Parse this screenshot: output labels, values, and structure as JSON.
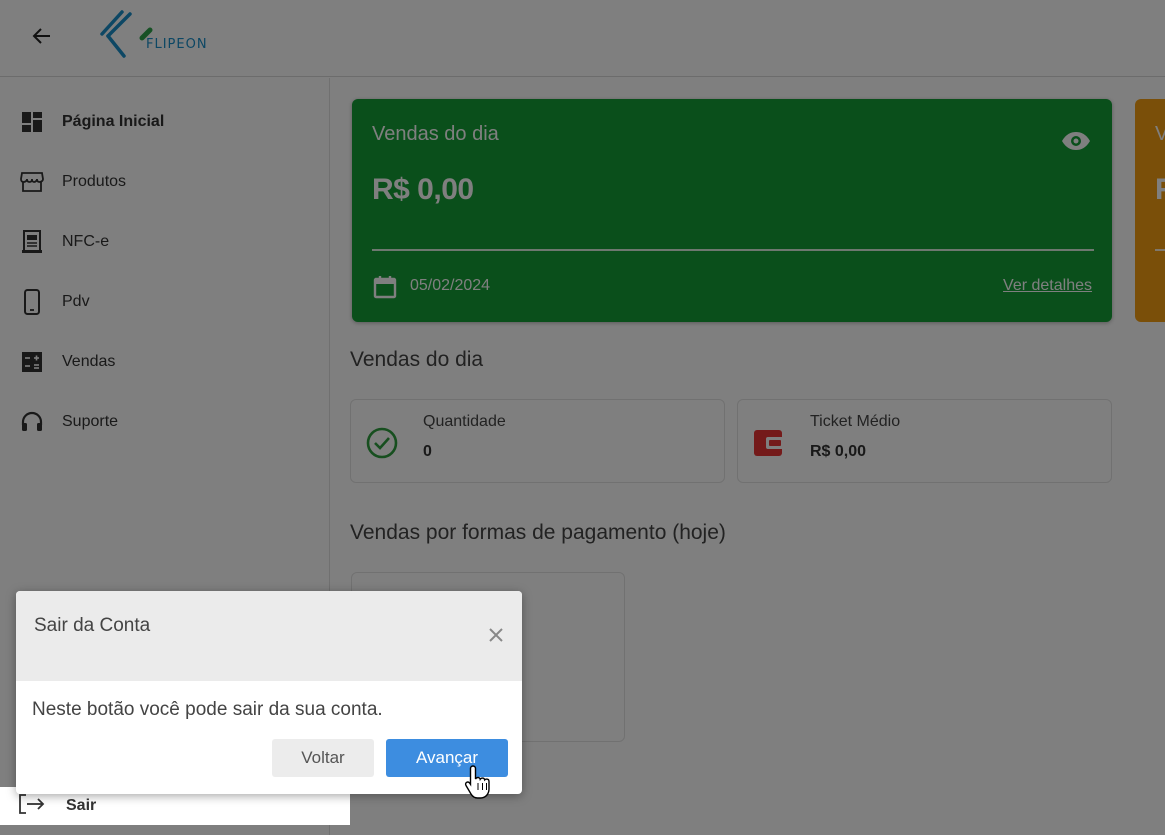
{
  "header": {
    "logo_text": "FLIPEON"
  },
  "sidebar": {
    "items": [
      {
        "label": "Página Inicial",
        "icon": "dashboard-icon"
      },
      {
        "label": "Produtos",
        "icon": "store-icon"
      },
      {
        "label": "NFC-e",
        "icon": "receipt-icon"
      },
      {
        "label": "Pdv",
        "icon": "smartphone-icon"
      },
      {
        "label": "Vendas",
        "icon": "calculator-icon"
      },
      {
        "label": "Suporte",
        "icon": "headset-icon"
      }
    ],
    "logout_label": "Sair"
  },
  "sales_card": {
    "title": "Vendas do dia",
    "amount": "R$ 0,00",
    "date": "05/02/2024",
    "details_link": "Ver detalhes",
    "color": "#149f37"
  },
  "second_card": {
    "title_partial": "V",
    "amount_partial": "R",
    "color": "#f59e13"
  },
  "daily_section": {
    "title": "Vendas do dia",
    "quantity_label": "Quantidade",
    "quantity_value": "0",
    "ticket_label": "Ticket Médio",
    "ticket_value": "R$ 0,00"
  },
  "payments_section": {
    "title": "Vendas por formas de pagamento (hoje)"
  },
  "tour_dialog": {
    "title": "Sair da Conta",
    "body": "Neste botão você pode sair da sua conta.",
    "back_label": "Voltar",
    "next_label": "Avançar",
    "accent": "#3d8de0"
  }
}
